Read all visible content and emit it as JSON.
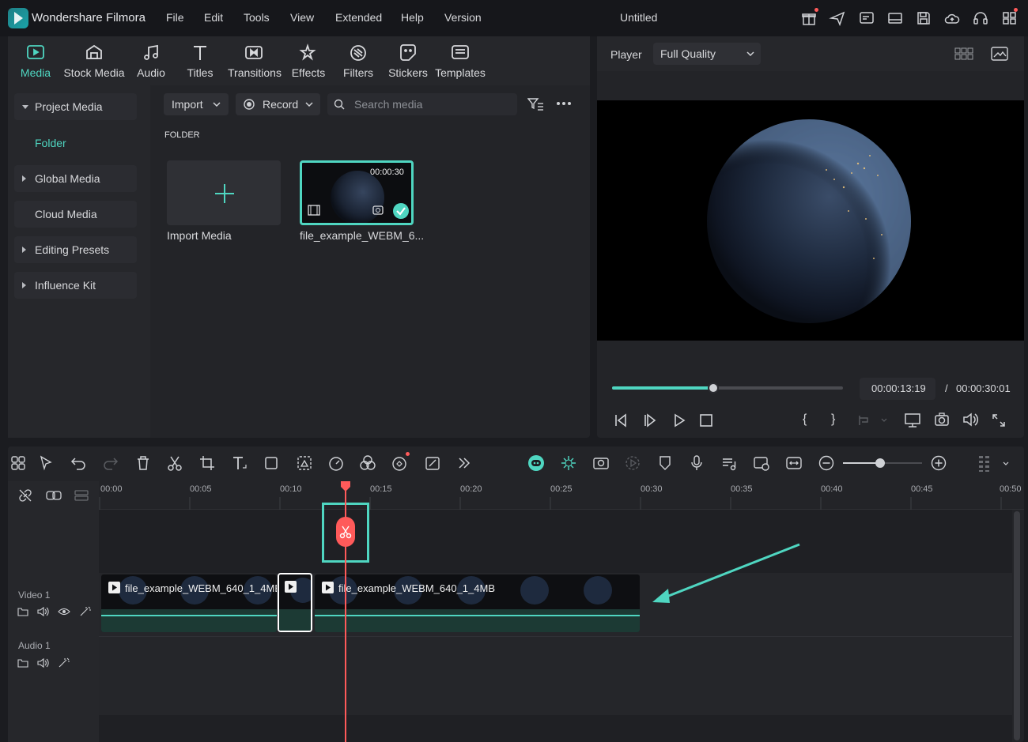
{
  "app": {
    "name": "Wondershare Filmora",
    "doc_title": "Untitled"
  },
  "menu": [
    "File",
    "Edit",
    "Tools",
    "View",
    "Extended",
    "Help",
    "Version"
  ],
  "tool_tabs": [
    "Media",
    "Stock Media",
    "Audio",
    "Titles",
    "Transitions",
    "Effects",
    "Filters",
    "Stickers",
    "Templates"
  ],
  "sidebar": {
    "project_media": "Project Media",
    "folder": "Folder",
    "items": [
      "Global Media",
      "Cloud Media",
      "Editing Presets",
      "Influence Kit"
    ]
  },
  "media_toolbar": {
    "import": "Import",
    "record": "Record",
    "search_placeholder": "Search media"
  },
  "folder_label": "FOLDER",
  "media_items": {
    "import_label": "Import Media",
    "clip_name": "file_example_WEBM_6...",
    "clip_duration": "00:00:30"
  },
  "player": {
    "label": "Player",
    "quality": "Full Quality",
    "current_time": "00:00:13:19",
    "separator": "/",
    "total_time": "00:00:30:01",
    "progress": 0.44
  },
  "timeline": {
    "ruler": [
      "00:00",
      "00:05",
      "00:10",
      "00:15",
      "00:20",
      "00:25",
      "00:30",
      "00:35",
      "00:40",
      "00:45",
      "00:50"
    ],
    "tracks": [
      "Video 1",
      "Audio 1"
    ],
    "clip_a": "file_example_WEBM_640_1_4MB",
    "clip_b": "file_example_WEBM_640_1_4MB",
    "zoom": 0.47
  },
  "colors": {
    "accent": "#4fd6c1",
    "playhead": "#ff5a5a",
    "bg": "#1b1c20"
  }
}
